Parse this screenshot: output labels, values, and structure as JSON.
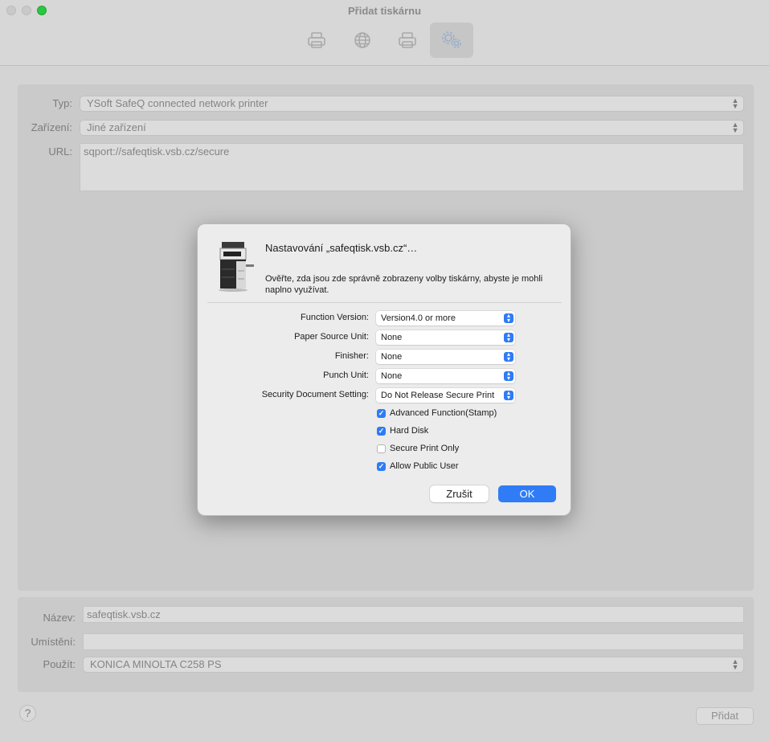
{
  "window": {
    "title": "Přidat tiskárnu",
    "toolbar": [
      {
        "icon": "default-printer-icon"
      },
      {
        "icon": "ip-globe-icon"
      },
      {
        "icon": "windows-printer-icon"
      },
      {
        "icon": "advanced-gears-icon",
        "selected": true
      }
    ]
  },
  "form": {
    "type_label": "Typ:",
    "type_value": "YSoft SafeQ connected network printer",
    "device_label": "Zařízení:",
    "device_value": "Jiné zařízení",
    "url_label": "URL:",
    "url_value": "sqport://safeqtisk.vsb.cz/secure"
  },
  "bottom": {
    "name_label": "Název:",
    "name_value": "safeqtisk.vsb.cz",
    "location_label": "Umístění:",
    "location_value": "",
    "use_label": "Použít:",
    "use_value": "KONICA MINOLTA C258 PS",
    "help_label": "?",
    "add_label": "Přidat"
  },
  "dialog": {
    "title": "Nastavování „safeqtisk.vsb.cz“…",
    "message": "Ověřte, zda jsou zde správně zobrazeny volby tiskárny, abyste je mohli naplno využívat.",
    "options": [
      {
        "label": "Function Version:",
        "value": "Version4.0 or more"
      },
      {
        "label": "Paper Source Unit:",
        "value": "None"
      },
      {
        "label": "Finisher:",
        "value": "None"
      },
      {
        "label": "Punch Unit:",
        "value": "None"
      },
      {
        "label": "Security Document Setting:",
        "value": "Do Not Release Secure Print"
      }
    ],
    "checkboxes": [
      {
        "label": "Advanced Function(Stamp)",
        "checked": true
      },
      {
        "label": "Hard Disk",
        "checked": true
      },
      {
        "label": "Secure Print Only",
        "checked": false
      },
      {
        "label": "Allow Public User",
        "checked": true
      }
    ],
    "cancel_label": "Zrušit",
    "ok_label": "OK"
  },
  "colors": {
    "accent": "#2f7cf6",
    "zoom_button": "#2ac840"
  }
}
